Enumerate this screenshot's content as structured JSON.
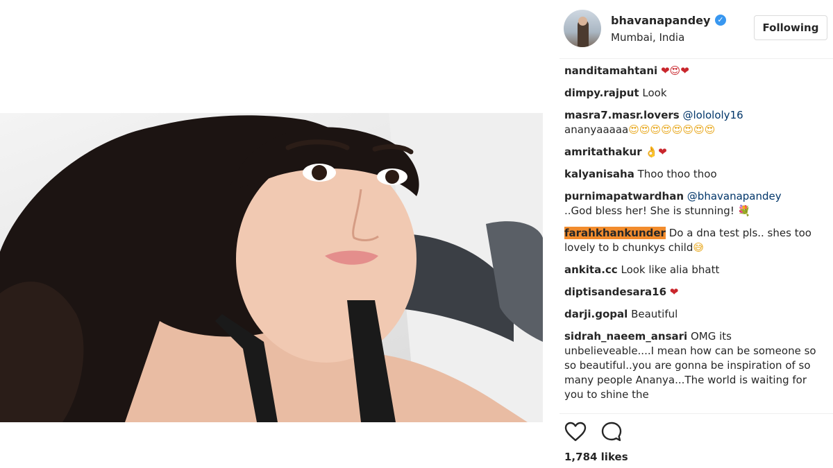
{
  "post": {
    "username": "bhavanapandey",
    "location": "Mumbai, India",
    "follow_label": "Following",
    "likes": "1,784 likes"
  },
  "comments": [
    {
      "author": "nanditamahtani",
      "text": "",
      "emoji": "❤😍❤"
    },
    {
      "author": "dimpy.rajput",
      "text": "Look",
      "emoji": ""
    },
    {
      "author": "masra7.masr.lovers",
      "mention": "@lolololy16",
      "text": "ananyaaaaa",
      "emoji": "😍😍😍😍😍😍😍😍"
    },
    {
      "author": "amritathakur",
      "text": "",
      "emoji": "👌❤"
    },
    {
      "author": "kalyanisaha",
      "text": "Thoo thoo thoo",
      "emoji": ""
    },
    {
      "author": "purnimapatwardhan",
      "mention": "@bhavanapandey",
      "text": "..God bless her! She is stunning!",
      "emoji": "💐"
    },
    {
      "author": "farahkhankunder",
      "text": "Do a dna test pls.. shes too lovely to b chunkys child",
      "emoji": "😅",
      "highlight": true
    },
    {
      "author": "ankita.cc",
      "text": "Look like alia bhatt",
      "emoji": ""
    },
    {
      "author": "diptisandesara16",
      "text": "",
      "emoji": "❤"
    },
    {
      "author": "darji.gopal",
      "text": "Beautiful",
      "emoji": ""
    },
    {
      "author": "sidrah_naeem_ansari",
      "text": "OMG its unbelieveable....I mean how can be someone so so beautiful..you are gonna be inspiration of so many people Ananya...The world is waiting for you to shine the",
      "emoji": ""
    }
  ],
  "icons": {
    "verified": "verified-badge-icon",
    "like": "heart-icon",
    "comment": "comment-bubble-icon"
  },
  "colors": {
    "highlight": "#f28c2d",
    "verified": "#3897f0",
    "heart": "#c9262c",
    "mention": "#003569"
  }
}
